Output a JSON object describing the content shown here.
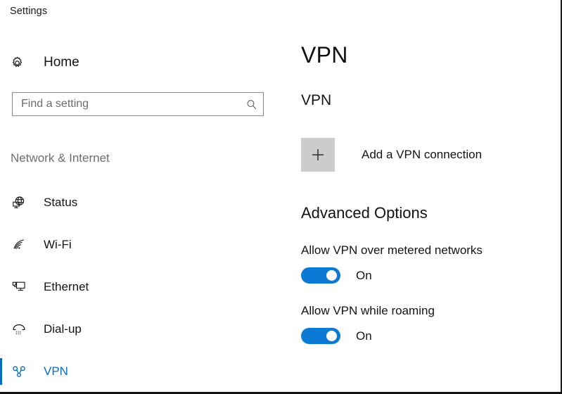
{
  "window": {
    "title": "Settings"
  },
  "sidebar": {
    "home": {
      "label": "Home",
      "icon": "gear-icon"
    },
    "search": {
      "placeholder": "Find a setting",
      "value": "",
      "icon": "search-icon"
    },
    "category": "Network & Internet",
    "items": [
      {
        "label": "Status",
        "icon": "globe-status-icon",
        "selected": false
      },
      {
        "label": "Wi-Fi",
        "icon": "wifi-icon",
        "selected": false
      },
      {
        "label": "Ethernet",
        "icon": "ethernet-icon",
        "selected": false
      },
      {
        "label": "Dial-up",
        "icon": "dialup-phone-icon",
        "selected": false
      },
      {
        "label": "VPN",
        "icon": "vpn-network-icon",
        "selected": true
      }
    ]
  },
  "content": {
    "page_title": "VPN",
    "vpn_section": {
      "heading": "VPN",
      "add_connection_label": "Add a VPN connection",
      "add_icon": "plus-icon"
    },
    "advanced_section": {
      "heading": "Advanced Options",
      "settings": [
        {
          "label": "Allow VPN over metered networks",
          "state": "On",
          "on": true
        },
        {
          "label": "Allow VPN while roaming",
          "state": "On",
          "on": true
        }
      ]
    }
  },
  "colors": {
    "accent": "#0a6cc4",
    "toggle_on": "#0a7ad4",
    "tile_gray": "#cccccc",
    "muted_text": "#6e6e6e"
  }
}
